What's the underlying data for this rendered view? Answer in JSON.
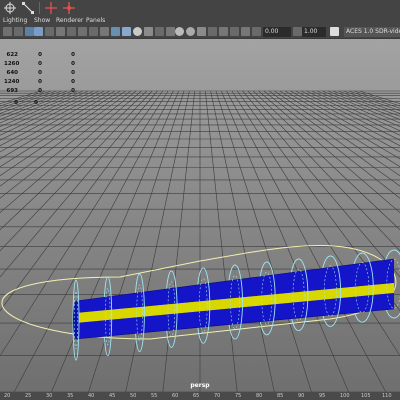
{
  "menu": [
    "Lighting",
    "Show",
    "Renderer",
    "Panels"
  ],
  "toolbar": {
    "exposure_value": "0.00",
    "gamma_value": "1.00",
    "color_space": "ACES 1.0 SDR-video (sRGB)"
  },
  "hud": {
    "rows": [
      {
        "a": "622",
        "b": "0",
        "c": "0"
      },
      {
        "a": "1260",
        "b": "0",
        "c": "0"
      },
      {
        "a": "640",
        "b": "0",
        "c": "0"
      },
      {
        "a": "1240",
        "b": "0",
        "c": "0"
      },
      {
        "a": "693",
        "b": "0",
        "c": "0"
      },
      {
        "a": "0",
        "b": "0",
        "c": ""
      }
    ]
  },
  "camera_label": "persp",
  "ruler_ticks": [
    "20",
    "25",
    "30",
    "35",
    "40",
    "45",
    "50",
    "55",
    "60",
    "65",
    "70",
    "75",
    "80",
    "85",
    "90",
    "95",
    "100",
    "105",
    "110"
  ],
  "colors": {
    "tube_blue": "#1414c8",
    "tube_yellow": "#d8d800",
    "wire_cyan": "#9ee6f5",
    "curve_yellow": "#f4f0b0",
    "grid": "#3c3c3c"
  }
}
